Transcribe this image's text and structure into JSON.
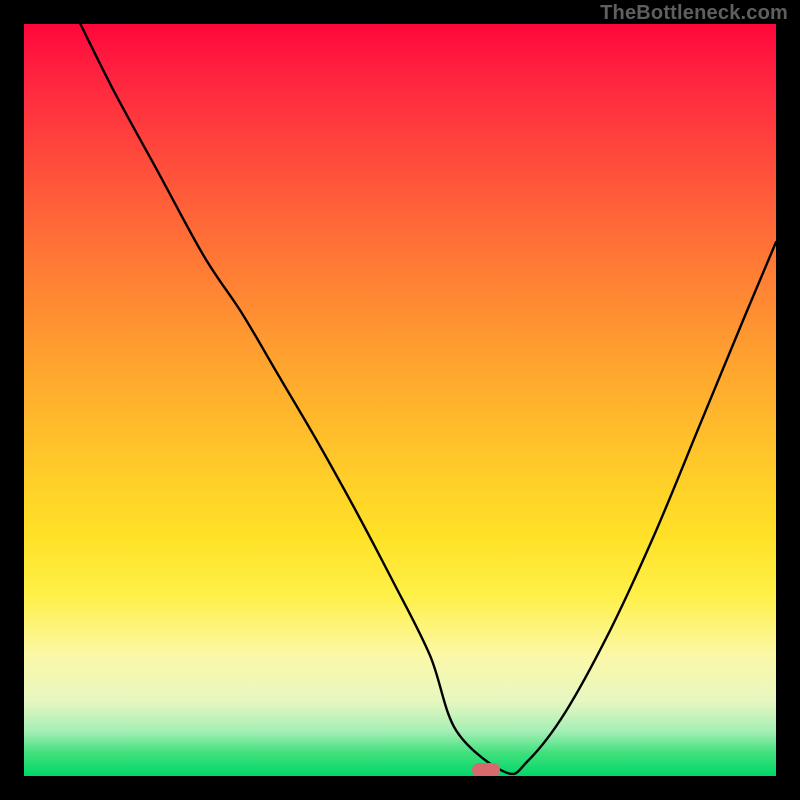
{
  "watermark": "TheBottleneck.com",
  "marker": {
    "cx_frac": 0.614,
    "cy_frac": 0.992
  },
  "chart_data": {
    "type": "line",
    "title": "",
    "xlabel": "",
    "ylabel": "",
    "xlim": [
      0,
      1
    ],
    "ylim": [
      0,
      1
    ],
    "series": [
      {
        "name": "bottleneck-curve",
        "x": [
          0.075,
          0.12,
          0.18,
          0.24,
          0.29,
          0.34,
          0.39,
          0.44,
          0.49,
          0.54,
          0.575,
          0.64,
          0.67,
          0.72,
          0.78,
          0.84,
          0.9,
          0.96,
          1.0
        ],
        "y": [
          1.0,
          0.91,
          0.8,
          0.69,
          0.615,
          0.53,
          0.445,
          0.355,
          0.26,
          0.16,
          0.06,
          0.005,
          0.02,
          0.085,
          0.195,
          0.325,
          0.47,
          0.615,
          0.71
        ]
      }
    ],
    "annotations": [
      {
        "type": "marker",
        "shape": "pill",
        "x": 0.614,
        "y": 0.008,
        "color": "#d66a6d"
      }
    ]
  }
}
